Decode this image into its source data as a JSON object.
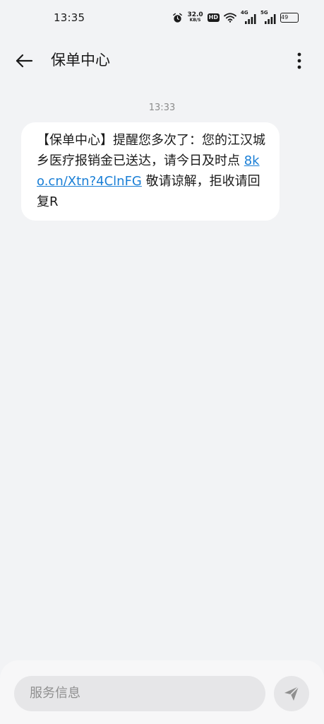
{
  "status_bar": {
    "time": "13:35",
    "net_speed_value": "32.0",
    "net_speed_unit": "KB/S",
    "hd_label": "HD",
    "sim1_label": "4G",
    "sim2_label": "5G",
    "battery": "49",
    "icons": [
      "alarm-icon",
      "wifi-icon",
      "signal-icon",
      "battery-icon"
    ]
  },
  "header": {
    "title": "保单中心",
    "back_icon": "arrow-left-icon",
    "more_icon": "more-vertical-icon"
  },
  "conversation": {
    "timestamp": "13:33",
    "message": {
      "before_link": "【保单中心】提醒您多次了：您的江汉城乡医疗报销金已送达，请今日及时点 ",
      "link": "8ko.cn/Xtn?4ClnFG",
      "after_link": " 敬请谅解，拒收请回复R"
    }
  },
  "compose": {
    "placeholder": "服务信息",
    "send_icon": "send-icon"
  },
  "colors": {
    "background": "#f2f3f5",
    "bubble": "#ffffff",
    "link": "#1a7fd6",
    "input": "#e6e6e8"
  }
}
